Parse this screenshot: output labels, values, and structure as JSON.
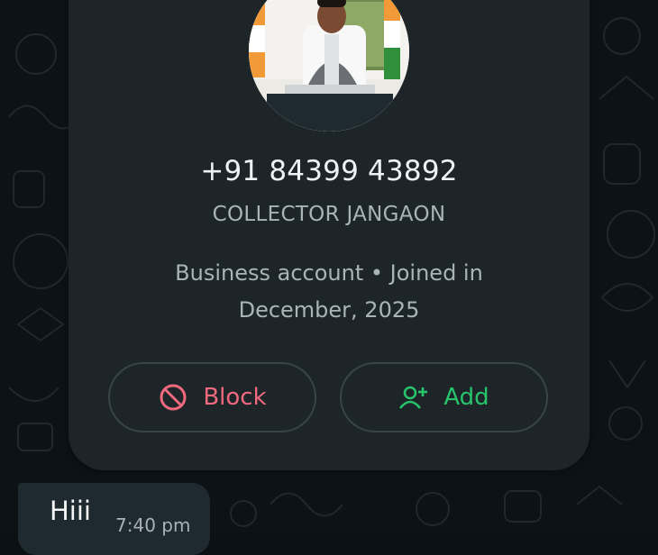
{
  "contact": {
    "phone": "+91 84399 43892",
    "name": "COLLECTOR JANGAON",
    "info_line1": "Business account • Joined in",
    "info_line2": "December, 2025"
  },
  "actions": {
    "block_label": "Block",
    "add_label": "Add"
  },
  "message": {
    "text": "Hiii",
    "time": "7:40 pm"
  },
  "icons": {
    "block": "block-icon",
    "add_contact": "add-person-icon"
  },
  "colors": {
    "card_background": "#1d2529",
    "block_red": "#f0697c",
    "add_green": "#27c46b",
    "bubble_background": "#1f2a30"
  }
}
